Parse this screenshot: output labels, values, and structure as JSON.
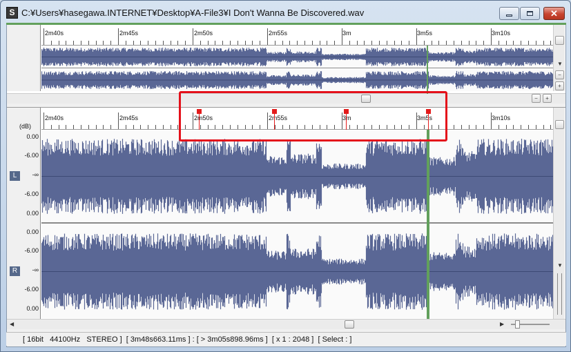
{
  "window": {
    "title": "C:¥Users¥hasegawa.INTERNET¥Desktop¥A-File3¥I Don't Wanna Be Discovered.wav",
    "icon_label": "S",
    "close_glyph": "✕"
  },
  "ruler_labels": [
    "2m40s",
    "2m45s",
    "2m50s",
    "2m55s",
    "3m",
    "3m5s",
    "3m10s"
  ],
  "db_unit": "(dB)",
  "db_labels": [
    "0.00",
    "-6.00",
    "-∞",
    "-6.00",
    "0.00"
  ],
  "channels": {
    "left": "L",
    "right": "R"
  },
  "zoom_buttons": {
    "minus": "−",
    "plus": "+"
  },
  "status": "[ 16bit   44100Hz   STEREO ]  [ 3m48s663.11ms ] : [ > 3m05s898.96ms ]  [ x 1 : 2048 ]  [ Select : ]",
  "colors": {
    "waveform": "#5a6795",
    "cursor": "#62a05c",
    "marker": "#e31b1b",
    "highlight": "#e4101a"
  }
}
